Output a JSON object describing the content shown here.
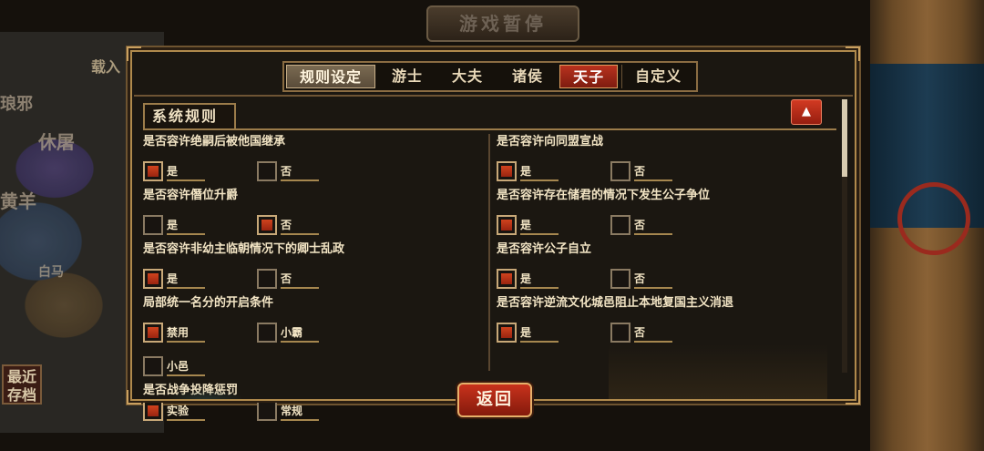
{
  "background": {
    "banner_title": "游戏暂停",
    "load_label": "载入",
    "recent_save_label": "最近\n存档",
    "map_labels": [
      "琅邪",
      "休屠",
      "黄羊",
      "白马"
    ]
  },
  "tabs": [
    {
      "label": "规则设定",
      "state": "system"
    },
    {
      "label": "游士",
      "state": "normal"
    },
    {
      "label": "大夫",
      "state": "normal"
    },
    {
      "label": "诸侯",
      "state": "normal"
    },
    {
      "label": "天子",
      "state": "active"
    },
    {
      "label": "自定义",
      "state": "normal"
    }
  ],
  "section": {
    "title": "系统规则",
    "collapse_icon": "▲"
  },
  "left_rules": [
    {
      "question": "是否容许绝嗣后被他国继承",
      "options": [
        {
          "label": "是",
          "checked": true
        },
        {
          "label": "否",
          "checked": false
        }
      ]
    },
    {
      "question": "是否容许僭位升爵",
      "options": [
        {
          "label": "是",
          "checked": false
        },
        {
          "label": "否",
          "checked": true
        }
      ]
    },
    {
      "question": "是否容许非幼主临朝情况下的卿士乱政",
      "options": [
        {
          "label": "是",
          "checked": true
        },
        {
          "label": "否",
          "checked": false
        }
      ]
    },
    {
      "question": "局部统一名分的开启条件",
      "options": [
        {
          "label": "禁用",
          "checked": true
        },
        {
          "label": "小霸",
          "checked": false
        },
        {
          "label": "小邑",
          "checked": false
        }
      ]
    },
    {
      "question": "是否战争投降惩罚",
      "options": [
        {
          "label": "实验",
          "checked": true
        },
        {
          "label": "常规",
          "checked": false
        }
      ]
    }
  ],
  "right_rules": [
    {
      "question": "是否容许向同盟宣战",
      "options": [
        {
          "label": "是",
          "checked": true
        },
        {
          "label": "否",
          "checked": false
        }
      ]
    },
    {
      "question": "是否容许存在储君的情况下发生公子争位",
      "options": [
        {
          "label": "是",
          "checked": true
        },
        {
          "label": "否",
          "checked": false
        }
      ]
    },
    {
      "question": "是否容许公子自立",
      "options": [
        {
          "label": "是",
          "checked": true
        },
        {
          "label": "否",
          "checked": false
        }
      ]
    },
    {
      "question": "是否容许逆流文化城邑阻止本地复国主义消退",
      "options": [
        {
          "label": "是",
          "checked": true
        },
        {
          "label": "否",
          "checked": false
        }
      ]
    }
  ],
  "back_button": "返回"
}
